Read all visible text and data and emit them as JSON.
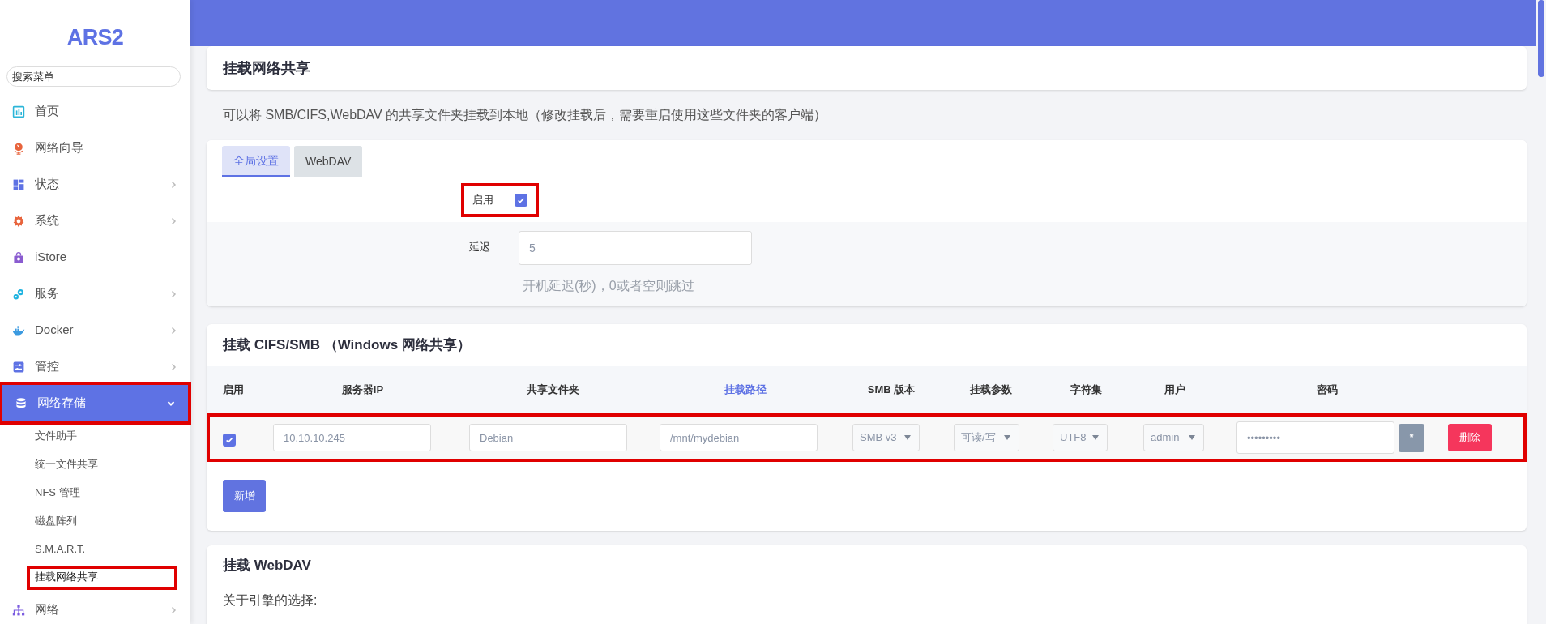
{
  "sidebar": {
    "logo": "ARS2",
    "search": {
      "placeholder": "搜索菜单"
    },
    "items": [
      {
        "label": "首页",
        "selected": false,
        "highlighted": false
      },
      {
        "label": "网络向导",
        "selected": false,
        "highlighted": false
      },
      {
        "label": "状态",
        "selected": false,
        "expanded": false,
        "highlighted": false
      },
      {
        "label": "系统",
        "selected": false,
        "expanded": false,
        "highlighted": false
      },
      {
        "label": "iStore",
        "selected": false,
        "highlighted": false
      },
      {
        "label": "服务",
        "selected": false,
        "expanded": false,
        "highlighted": false
      },
      {
        "label": "Docker",
        "selected": false,
        "expanded": false,
        "highlighted": false
      },
      {
        "label": "管控",
        "selected": false,
        "expanded": false,
        "highlighted": false
      },
      {
        "label": "网络存储",
        "selected": true,
        "expanded": true,
        "highlighted": true,
        "children": [
          {
            "label": "文件助手",
            "selected": false,
            "highlighted": false
          },
          {
            "label": "统一文件共享",
            "selected": false,
            "highlighted": false
          },
          {
            "label": "NFS 管理",
            "selected": false,
            "highlighted": false
          },
          {
            "label": "磁盘阵列",
            "selected": false,
            "highlighted": false
          },
          {
            "label": "S.M.A.R.T.",
            "selected": false,
            "highlighted": false
          },
          {
            "label": "挂载网络共享",
            "selected": true,
            "highlighted": true
          }
        ]
      },
      {
        "label": "网络",
        "selected": false,
        "expanded": false,
        "highlighted": false
      }
    ]
  },
  "page": {
    "title": "挂载网络共享",
    "description": "可以将 SMB/CIFS,WebDAV 的共享文件夹挂载到本地（修改挂载后，需要重启使用这些文件夹的客户端）"
  },
  "settings": {
    "tabs": [
      {
        "label": "全局设置",
        "selected": true
      },
      {
        "label": "WebDAV",
        "selected": false
      }
    ],
    "enable": {
      "label": "启用",
      "checked": true,
      "highlighted": true
    },
    "delay": {
      "label": "延迟",
      "value": "5",
      "hint": "开机延迟(秒)，0或者空则跳过"
    }
  },
  "smb": {
    "title": "挂载 CIFS/SMB （Windows 网络共享）",
    "columns": [
      {
        "label": "启用",
        "highlighted": false
      },
      {
        "label": "服务器IP",
        "highlighted": false
      },
      {
        "label": "共享文件夹",
        "highlighted": false
      },
      {
        "label": "挂载路径",
        "highlighted": true
      },
      {
        "label": "SMB 版本",
        "highlighted": false
      },
      {
        "label": "挂载参数",
        "highlighted": false
      },
      {
        "label": "字符集",
        "highlighted": false
      },
      {
        "label": "用户",
        "highlighted": false
      },
      {
        "label": "密码",
        "highlighted": false
      }
    ],
    "rows": [
      {
        "enabled": true,
        "server_ip": "10.10.10.245",
        "share": "Debian",
        "mount_path": "/mnt/mydebian",
        "smb_version": "SMB v3",
        "options": "可读/写",
        "charset": "UTF8",
        "user": "admin",
        "password": "•••••••••",
        "reveal_button": "*",
        "delete_button": "删除",
        "highlighted": true
      }
    ],
    "add_button": "新增"
  },
  "webdav": {
    "title": "挂载 WebDAV",
    "text": "关于引擎的选择:"
  }
}
